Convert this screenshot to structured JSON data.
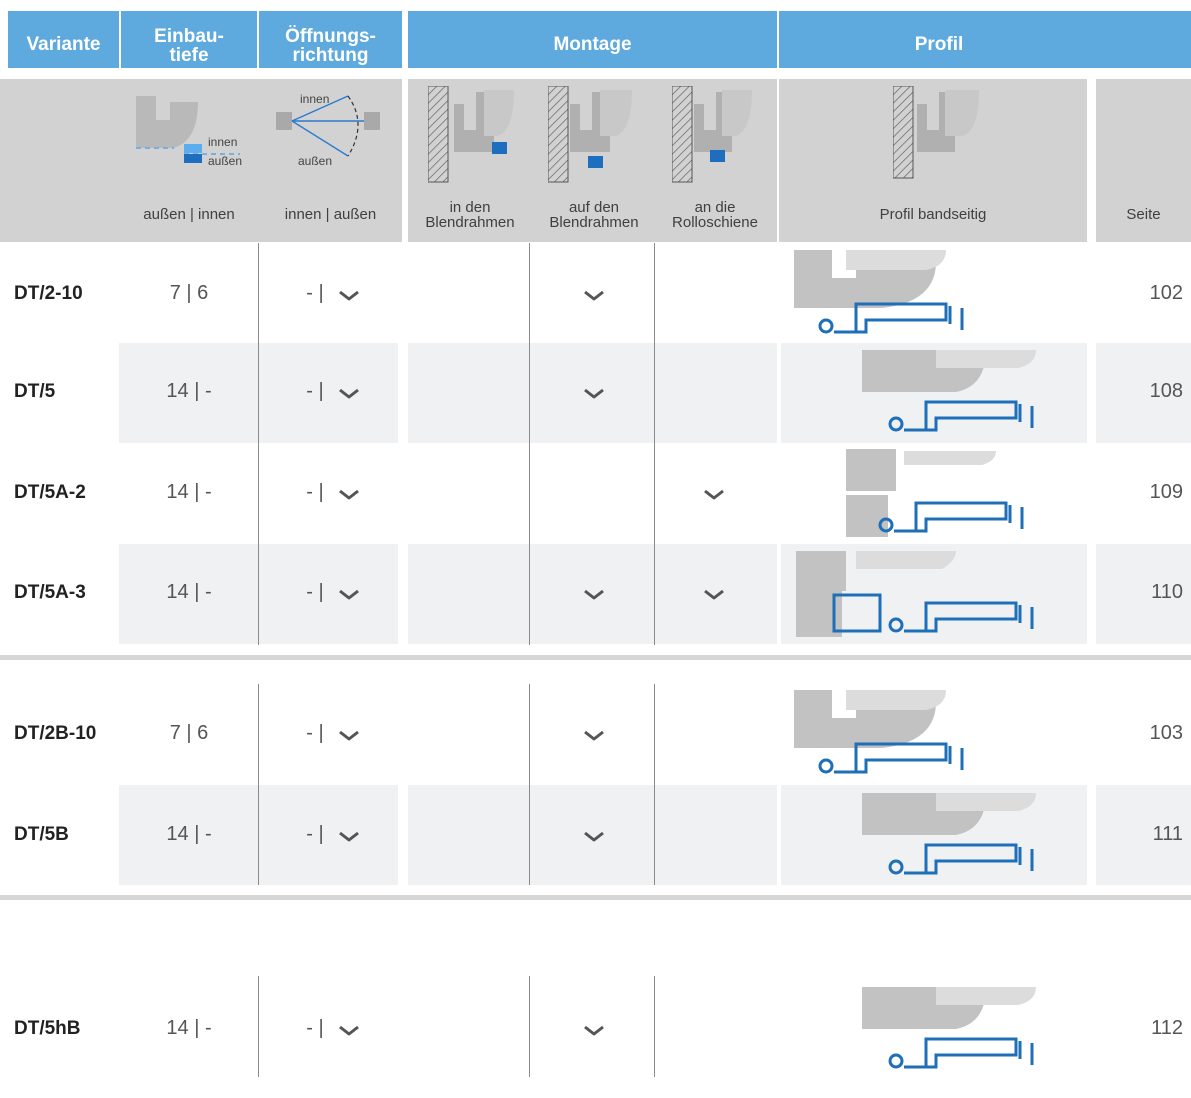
{
  "header": {
    "variante": "Variante",
    "einbautiefe": "Einbau-\ntiefe",
    "oeffnungsrichtung": "Öffnungs-\nrichtung",
    "montage": "Montage",
    "profil": "Profil"
  },
  "subheader": {
    "einbautiefe_label": "außen | innen",
    "oeffnung_label": "innen | außen",
    "montage_1": "in den\nBlendrahmen",
    "montage_2": "auf den\nBlendrahmen",
    "montage_3": "an die\nRolloschiene",
    "profil_label": "Profil bandseitig",
    "seite_label": "Seite",
    "icon_innen": "innen",
    "icon_aussen": "außen",
    "swing_innen": "innen",
    "swing_aussen": "außen"
  },
  "rows": [
    {
      "name": "DT/2-10",
      "einbautiefe": "7 | 6",
      "oeffnung": "- |",
      "in_den": false,
      "auf_den": true,
      "an_die": false,
      "seite": "102"
    },
    {
      "name": "DT/5",
      "einbautiefe": "14 | -",
      "oeffnung": "- |",
      "in_den": false,
      "auf_den": true,
      "an_die": false,
      "seite": "108"
    },
    {
      "name": "DT/5A-2",
      "einbautiefe": "14 | -",
      "oeffnung": "- |",
      "in_den": false,
      "auf_den": false,
      "an_die": true,
      "seite": "109"
    },
    {
      "name": "DT/5A-3",
      "einbautiefe": "14 | -",
      "oeffnung": "- |",
      "in_den": false,
      "auf_den": true,
      "an_die": true,
      "seite": "110"
    },
    {
      "name": "DT/2B-10",
      "einbautiefe": "7 | 6",
      "oeffnung": "- |",
      "in_den": false,
      "auf_den": true,
      "an_die": false,
      "seite": "103"
    },
    {
      "name": "DT/5B",
      "einbautiefe": "14 | -",
      "oeffnung": "- |",
      "in_den": false,
      "auf_den": true,
      "an_die": false,
      "seite": "111"
    },
    {
      "name": "DT/5hB",
      "einbautiefe": "14 | -",
      "oeffnung": "- |",
      "in_den": false,
      "auf_den": true,
      "an_die": false,
      "seite": "112"
    }
  ],
  "colors": {
    "header_blue": "#5ea9de",
    "profile_blue": "#1f6fb8",
    "accent_blue": "#1e6ec0",
    "light_blue": "#5aaef0",
    "sub_grey": "#d2d2d2",
    "row_shade": "#eff1f3"
  }
}
